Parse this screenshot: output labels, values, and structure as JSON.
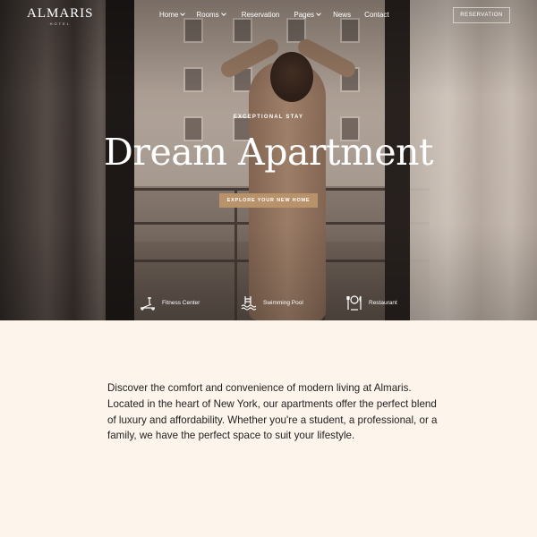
{
  "header": {
    "logo": "ALMARIS",
    "logo_sub": "HOTEL",
    "nav": [
      {
        "label": "Home",
        "has_dropdown": true
      },
      {
        "label": "Rooms",
        "has_dropdown": true
      },
      {
        "label": "Reservation",
        "has_dropdown": false
      },
      {
        "label": "Pages",
        "has_dropdown": true
      },
      {
        "label": "News",
        "has_dropdown": false
      },
      {
        "label": "Contact",
        "has_dropdown": false
      }
    ],
    "reservation_button": "RESERVATION"
  },
  "hero": {
    "eyebrow": "EXCEPTIONAL STAY",
    "title": "Dream Apartment",
    "cta": "EXPLORE YOUR NEW HOME",
    "features": [
      {
        "label": "Fitness Center",
        "icon": "treadmill-icon"
      },
      {
        "label": "Swimming Pool",
        "icon": "pool-icon"
      },
      {
        "label": "Restaurant",
        "icon": "dining-icon"
      }
    ]
  },
  "intro": {
    "text": "Discover the comfort and convenience of modern living at Almaris. Located in the heart of New York, our apartments offer the perfect blend of luxury and affordability. Whether you're a student, a professional, or a family, we have the perfect space to suit your lifestyle."
  },
  "colors": {
    "accent": "#b8926a",
    "background": "#fdf4ec",
    "text": "#222222"
  }
}
